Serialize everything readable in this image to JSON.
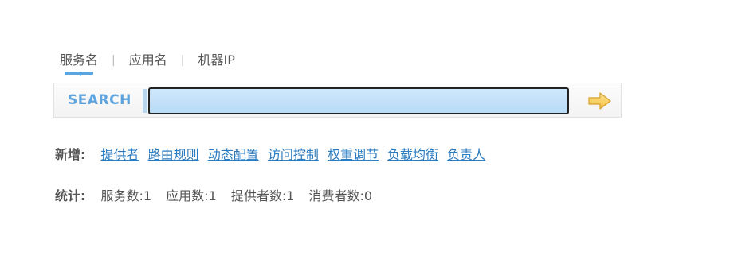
{
  "tabs": [
    {
      "label": "服务名",
      "active": true
    },
    {
      "label": "应用名",
      "active": false
    },
    {
      "label": "机器IP",
      "active": false
    }
  ],
  "tab_separator": "|",
  "search": {
    "label": "SEARCH",
    "value": "",
    "placeholder": "",
    "submit_icon": "right-arrow-icon"
  },
  "add_row": {
    "label": "新增:",
    "links": [
      "提供者",
      "路由规则",
      "动态配置",
      "访问控制",
      "权重调节",
      "负载均衡",
      "负责人"
    ]
  },
  "stats_row": {
    "label": "统计:",
    "items": [
      "服务数:1",
      "应用数:1",
      "提供者数:1",
      "消费者数:0"
    ]
  },
  "colors": {
    "accent": "#5aa5e0",
    "link": "#2b7bc0",
    "input_bg": "#c6e2f8",
    "arrow": "#f5c84c"
  }
}
